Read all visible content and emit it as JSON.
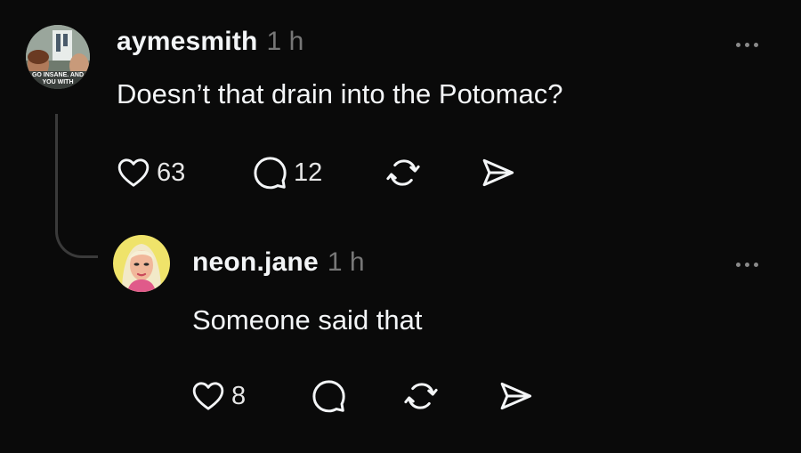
{
  "posts": [
    {
      "username": "aymesmith",
      "time": "1 h",
      "text": "Doesn’t that drain into the Potomac?",
      "avatar_text_line1": "GO INSANE. AND",
      "avatar_text_line2": "YOU WITH",
      "likes": "63",
      "replies": "12"
    },
    {
      "username": "neon.jane",
      "time": "1 h",
      "text": "Someone said that",
      "likes": "8"
    }
  ],
  "icons": {
    "like": "heart-icon",
    "reply": "comment-icon",
    "repost": "repost-icon",
    "share": "send-icon",
    "more": "more-icon"
  },
  "colors": {
    "background": "#0a0a0a",
    "text": "#f3f5f7",
    "muted": "#777777",
    "thread_line": "#3a3a3a"
  }
}
